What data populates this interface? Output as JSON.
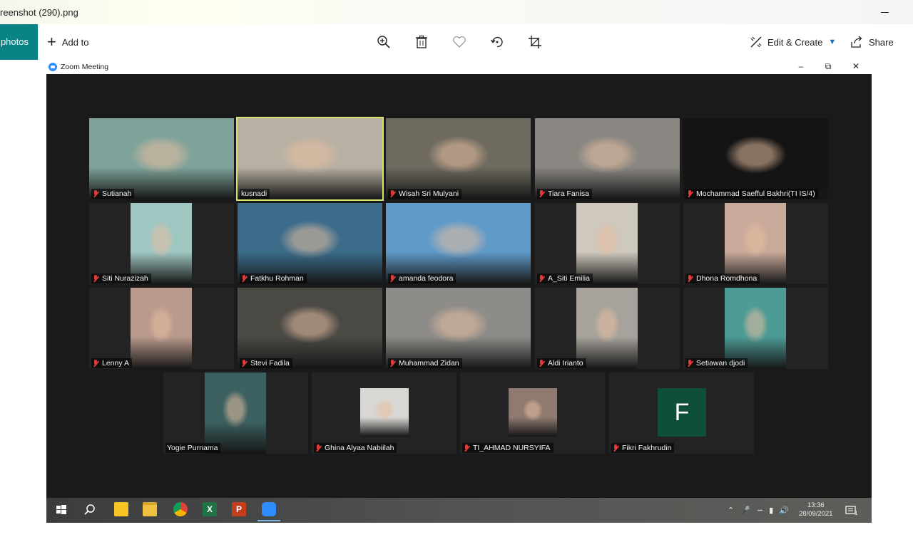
{
  "photos_app": {
    "window_title": "reenshot (290).png",
    "photos_label": "photos",
    "add_to_label": "Add to",
    "edit_create_label": "Edit & Create",
    "share_label": "Share",
    "toolbar_icons": [
      "zoom-in-icon",
      "delete-icon",
      "heart-icon",
      "rotate-icon",
      "crop-icon"
    ]
  },
  "zoom": {
    "window_title": "Zoom Meeting",
    "participants": [
      {
        "name": "Sutianah",
        "muted": true,
        "bg": "#7fa39a"
      },
      {
        "name": "kusnadi",
        "muted": false,
        "bg": "#b8b0a3",
        "active": true
      },
      {
        "name": "Wisah Sri Mulyani",
        "muted": true,
        "bg": "#6e6a5f"
      },
      {
        "name": "Tiara Fanisa",
        "muted": true,
        "bg": "#8a8782"
      },
      {
        "name": "Mochammad Saefful Bakhri(TI IS/4)",
        "muted": true,
        "bg": "#141414"
      },
      {
        "name": "Siti Nurazizah",
        "muted": true,
        "bg": "#9fc7c2"
      },
      {
        "name": "Fatkhu Rohman",
        "muted": true,
        "bg": "#3b6c8a"
      },
      {
        "name": "amanda feodora",
        "muted": true,
        "bg": "#5f9ac9"
      },
      {
        "name": "A_Siti Emilia",
        "muted": true,
        "bg": "#cfc8bd"
      },
      {
        "name": "Dhona Romdhona",
        "muted": true,
        "bg": "#c9aa9a"
      },
      {
        "name": "Lenny A",
        "muted": true,
        "bg": "#b99a8c"
      },
      {
        "name": "Stevi Fadila",
        "muted": true,
        "bg": "#4b4a45"
      },
      {
        "name": "Muhammad Zidan",
        "muted": true,
        "bg": "#8e8c88"
      },
      {
        "name": "Aldi Irianto",
        "muted": true,
        "bg": "#a7a39c"
      },
      {
        "name": "Setiawan djodi",
        "muted": true,
        "bg": "#4c9b95"
      },
      {
        "name": "Yogie Purnama",
        "muted": false,
        "bg": "#3d6161"
      },
      {
        "name": "Ghina Alyaa Nabiilah",
        "muted": true,
        "bg": "#d9d7d3"
      },
      {
        "name": "TI_AHMAD NURSYIFA",
        "muted": true,
        "bg": "#8e7a6f"
      },
      {
        "name": "Fikri Fakhrudin",
        "muted": true,
        "initial": "F"
      }
    ]
  },
  "taskbar": {
    "time": "13:36",
    "date": "28/09/2021",
    "notification_count": "1",
    "apps": [
      "start-icon",
      "search-icon",
      "sticky-notes-icon",
      "file-explorer-icon",
      "chrome-icon",
      "excel-icon",
      "powerpoint-icon",
      "zoom-icon"
    ],
    "colors": {
      "excel": "#1f7244",
      "powerpoint": "#c43e1c",
      "zoom": "#2d8cff",
      "chrome_red": "#db4437",
      "sticky": "#f7c325",
      "explorer": "#f0c040"
    }
  }
}
